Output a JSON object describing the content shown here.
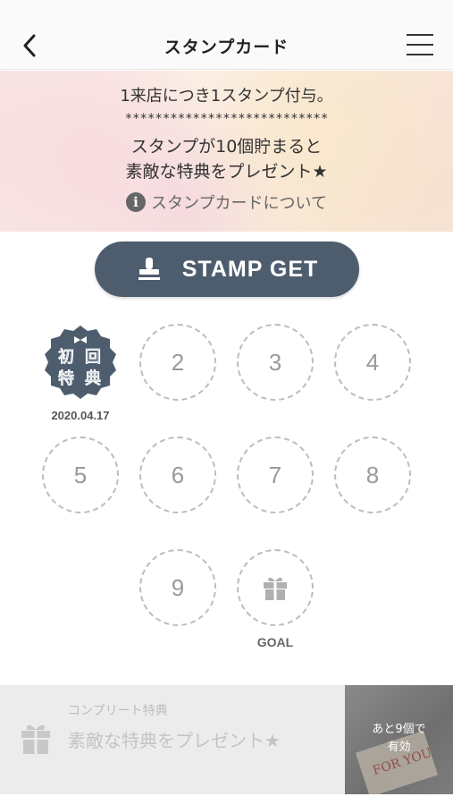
{
  "header": {
    "title": "スタンプカード"
  },
  "banner": {
    "line1": "1来店につき1スタンプ付与。",
    "stars": "***************************",
    "line2": "スタンプが10個貯まると",
    "line3": "素敵な特典をプレゼント★",
    "about_link": "スタンプカードについて"
  },
  "stamp_button": {
    "label": "STAMP GET"
  },
  "stamps": {
    "first": {
      "badge_chars": [
        "初",
        "回",
        "特",
        "典"
      ],
      "date": "2020.04.17"
    },
    "slots": [
      "2",
      "3",
      "4",
      "5",
      "6",
      "7",
      "8",
      "9"
    ],
    "goal_label": "GOAL"
  },
  "bottom": {
    "caption": "コンプリート特典",
    "title": "素敵な特典をプレゼント★",
    "remaining_line1": "あと9個で",
    "remaining_line2": "有効",
    "thumb_text": "FOR YOU"
  },
  "colors": {
    "button": "#4e5d6e",
    "slot_border": "#bdbdbd"
  }
}
